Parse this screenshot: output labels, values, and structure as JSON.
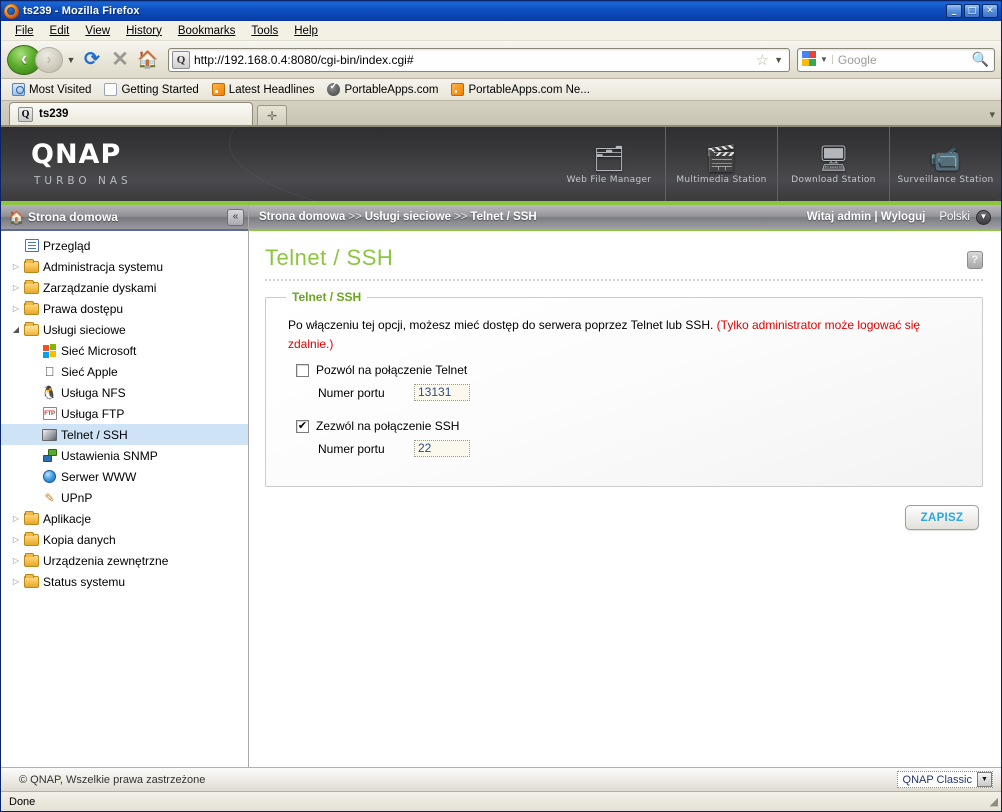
{
  "browser": {
    "title": "ts239 - Mozilla Firefox",
    "icon": "firefox-icon",
    "window_controls": {
      "minimize": "_",
      "maximize": "□",
      "close": "✕"
    },
    "menus": [
      "File",
      "Edit",
      "View",
      "History",
      "Bookmarks",
      "Tools",
      "Help"
    ],
    "nav": {
      "back": "‹",
      "forward": "›",
      "dropdown": "▼",
      "reload": "⟳",
      "stop": "✕",
      "home": "🏠"
    },
    "url": "http://192.168.0.4:8080/cgi-bin/index.cgi#",
    "url_favicon": "Q",
    "star": "☆",
    "url_caret": "▼",
    "search_placeholder": "Google",
    "search_caret": "▼",
    "search_icon": "🔍",
    "bookmarks": [
      {
        "label": "Most Visited",
        "icon": "most-visited-icon"
      },
      {
        "label": "Getting Started",
        "icon": "document-icon"
      },
      {
        "label": "Latest Headlines",
        "icon": "rss-icon"
      },
      {
        "label": "PortableApps.com",
        "icon": "portableapps-icon"
      },
      {
        "label": "PortableApps.com Ne...",
        "icon": "rss-icon"
      }
    ],
    "tab": {
      "label": "ts239",
      "favicon": "Q"
    },
    "new_tab": "✛",
    "tablist_menu": "▾",
    "status": "Done",
    "resize_grip": "◢"
  },
  "qnap": {
    "logo": "QNAP",
    "tagline": "TURBO NAS",
    "accent": "#8cc63f",
    "apps": [
      {
        "label": "Web File Manager",
        "icon": "folder-search-icon",
        "glyph": "🗂"
      },
      {
        "label": "Multimedia Station",
        "icon": "media-icon",
        "glyph": "🎬"
      },
      {
        "label": "Download Station",
        "icon": "download-icon",
        "glyph": "🖥"
      },
      {
        "label": "Surveillance Station",
        "icon": "camera-icon",
        "glyph": "📹"
      }
    ]
  },
  "sidebar": {
    "header": "Strona domowa",
    "header_icon": "home-icon",
    "collapse_icon": "«",
    "items": [
      {
        "label": "Przegląd",
        "icon": "overview-icon",
        "type": "leaf",
        "indent": 1,
        "twisty": ""
      },
      {
        "label": "Administracja systemu",
        "icon": "folder-icon",
        "type": "folder",
        "indent": 0,
        "twisty": "▷"
      },
      {
        "label": "Zarządzanie dyskami",
        "icon": "folder-icon",
        "type": "folder",
        "indent": 0,
        "twisty": "▷"
      },
      {
        "label": "Prawa dostępu",
        "icon": "folder-icon",
        "type": "folder",
        "indent": 0,
        "twisty": "▷"
      },
      {
        "label": "Usługi sieciowe",
        "icon": "folder-open-icon",
        "type": "folder-open",
        "indent": 0,
        "twisty": "◢"
      },
      {
        "label": "Sieć Microsoft",
        "icon": "windows-icon",
        "type": "leaf",
        "indent": 2,
        "twisty": ""
      },
      {
        "label": "Sieć Apple",
        "icon": "apple-icon",
        "type": "leaf",
        "indent": 2,
        "twisty": ""
      },
      {
        "label": "Usługa NFS",
        "icon": "linux-icon",
        "type": "leaf",
        "indent": 2,
        "twisty": ""
      },
      {
        "label": "Usługa FTP",
        "icon": "ftp-icon",
        "type": "leaf",
        "indent": 2,
        "twisty": ""
      },
      {
        "label": "Telnet / SSH",
        "icon": "telnet-icon",
        "type": "leaf",
        "indent": 2,
        "twisty": "",
        "selected": true
      },
      {
        "label": "Ustawienia SNMP",
        "icon": "snmp-icon",
        "type": "leaf",
        "indent": 2,
        "twisty": ""
      },
      {
        "label": "Serwer WWW",
        "icon": "web-icon",
        "type": "leaf",
        "indent": 2,
        "twisty": ""
      },
      {
        "label": "UPnP",
        "icon": "upnp-icon",
        "type": "leaf",
        "indent": 2,
        "twisty": ""
      },
      {
        "label": "Aplikacje",
        "icon": "folder-icon",
        "type": "folder",
        "indent": 0,
        "twisty": "▷"
      },
      {
        "label": "Kopia danych",
        "icon": "folder-icon",
        "type": "folder",
        "indent": 0,
        "twisty": "▷"
      },
      {
        "label": "Urządzenia zewnętrzne",
        "icon": "folder-icon",
        "type": "folder",
        "indent": 0,
        "twisty": "▷"
      },
      {
        "label": "Status systemu",
        "icon": "folder-icon",
        "type": "folder",
        "indent": 0,
        "twisty": "▷"
      }
    ]
  },
  "breadcrumb": {
    "part1": "Strona domowa",
    "sep1": ">>",
    "part2": "Usługi sieciowe",
    "sep2": ">>",
    "part3": "Telnet / SSH",
    "greeting": "Witaj admin | Wyloguj",
    "language": "Polski",
    "language_caret": "▼"
  },
  "main": {
    "title": "Telnet / SSH",
    "help_icon": "?",
    "legend": "Telnet / SSH",
    "description_plain": "Po włączeniu tej opcji, możesz mieć dostęp do serwera poprzez Telnet lub SSH. ",
    "description_warning": "(Tylko administrator może logować się zdalnie.)",
    "warning_color": "#e00000",
    "telnet": {
      "checkbox_label": "Pozwól na połączenie Telnet",
      "checked": false,
      "check_glyph": "",
      "port_label": "Numer portu",
      "port_value": "13131"
    },
    "ssh": {
      "checkbox_label": "Zezwól na połączenie SSH",
      "checked": true,
      "check_glyph": "✔",
      "port_label": "Numer portu",
      "port_value": "22"
    },
    "save_label": "ZAPISZ"
  },
  "footer": {
    "copyright": "© QNAP, Wszelkie prawa zastrzeżone",
    "theme": "QNAP Classic",
    "theme_caret": "▼"
  }
}
